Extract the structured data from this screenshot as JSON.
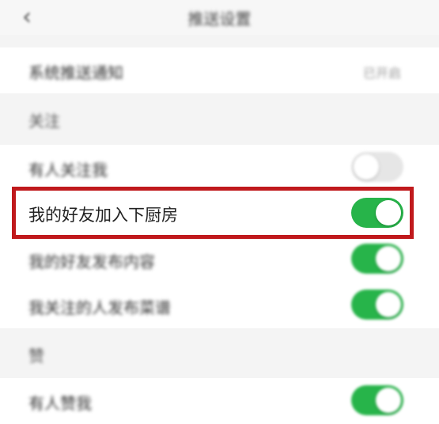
{
  "header": {
    "title": "推送设置",
    "back_icon": "chevron-left-icon"
  },
  "rows": {
    "system_push": {
      "label": "系统推送通知",
      "value": "已开启"
    },
    "follow_section": {
      "label": "关注"
    },
    "someone_follows": {
      "label": "有人关注我",
      "toggle": "off"
    },
    "friend_joins": {
      "label": "我的好友加入下厨房",
      "toggle": "on"
    },
    "friend_posts": {
      "label": "我的好友发布内容",
      "toggle": "on"
    },
    "followed_posts": {
      "label": "我关注的人发布菜谱",
      "toggle": "on"
    },
    "like_section": {
      "label": "赞"
    },
    "someone_likes": {
      "label": "有人赞我",
      "toggle": "on"
    }
  },
  "colors": {
    "toggle_on": "#27b44a",
    "toggle_off": "#e6e6e6",
    "highlight": "#c0191c"
  }
}
